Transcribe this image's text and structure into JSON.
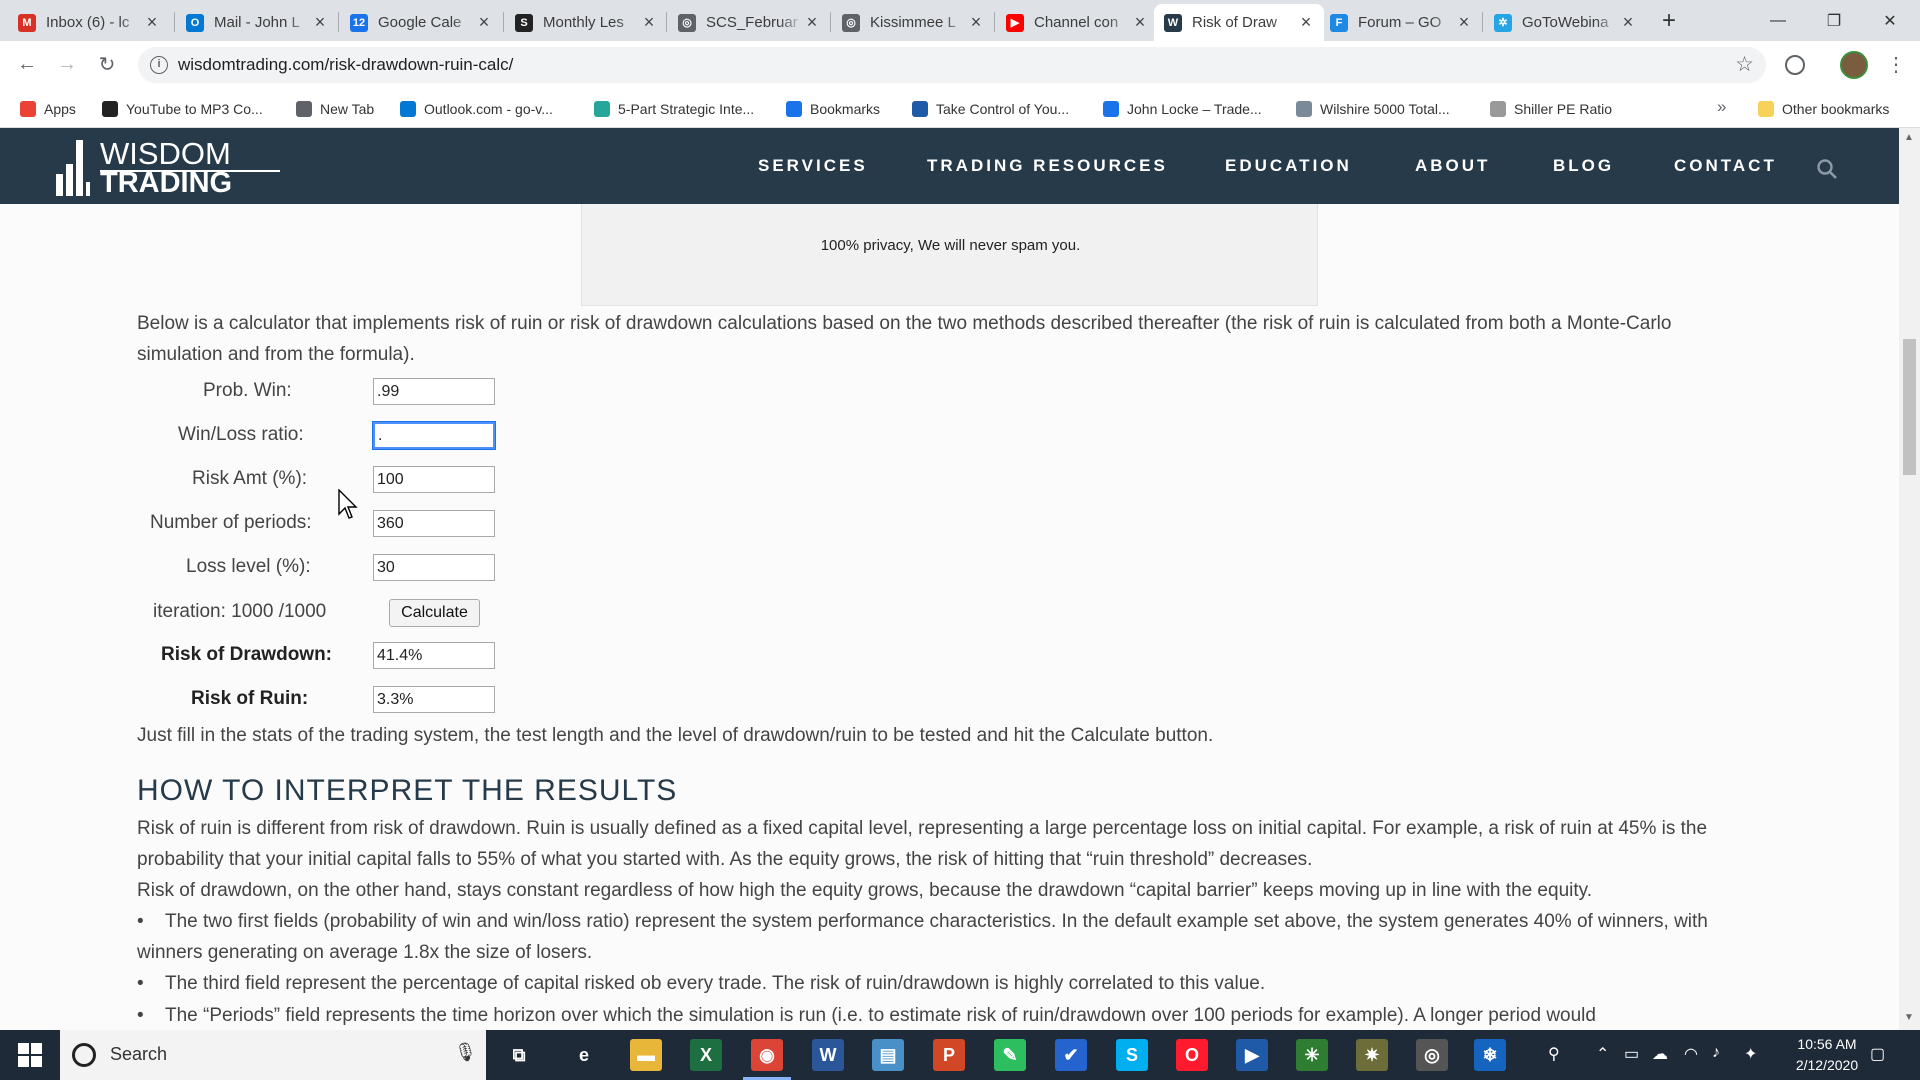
{
  "browser": {
    "tabs": [
      {
        "title": "Inbox (6) - lc",
        "icon": "gmail-icon",
        "color": "#d93025",
        "glyph": "M",
        "active": false
      },
      {
        "title": "Mail - John L",
        "icon": "outlook-icon",
        "color": "#0078d4",
        "glyph": "O",
        "active": false
      },
      {
        "title": "Google Cale",
        "icon": "calendar-icon",
        "color": "#1a73e8",
        "glyph": "12",
        "active": false
      },
      {
        "title": "Monthly Les",
        "icon": "scs-icon",
        "color": "#222222",
        "glyph": "S",
        "active": false
      },
      {
        "title": "SCS_Februar",
        "icon": "globe-icon",
        "color": "#5f6368",
        "glyph": "◎",
        "active": false
      },
      {
        "title": "Kissimmee L",
        "icon": "globe-icon",
        "color": "#5f6368",
        "glyph": "◎",
        "active": false
      },
      {
        "title": "Channel con",
        "icon": "youtube-icon",
        "color": "#ff0000",
        "glyph": "▶",
        "active": false
      },
      {
        "title": "Risk of Draw",
        "icon": "wisdom-icon",
        "color": "#263a4a",
        "glyph": "W",
        "active": true
      },
      {
        "title": "Forum – GO",
        "icon": "forum-icon",
        "color": "#1e88e5",
        "glyph": "F",
        "active": false
      },
      {
        "title": "GoToWebina",
        "icon": "gotowebinar-icon",
        "color": "#26a5e4",
        "glyph": "✲",
        "active": false
      }
    ],
    "new_tab": "+",
    "minimize": "—",
    "maximize": "❐",
    "close": "✕",
    "url": "wisdomtrading.com/risk-drawdown-ruin-calc/",
    "bookmarks": [
      {
        "label": "Apps",
        "icon": "apps-grid-icon",
        "color": "#ea4335"
      },
      {
        "label": "YouTube to MP3 Co...",
        "icon": "music-note-icon",
        "color": "#222222"
      },
      {
        "label": "New Tab",
        "icon": "globe-icon",
        "color": "#5f6368"
      },
      {
        "label": "Outlook.com - go-v...",
        "icon": "outlook-icon",
        "color": "#0078d4"
      },
      {
        "label": "5-Part Strategic Inte...",
        "icon": "circle-icon",
        "color": "#26a69a"
      },
      {
        "label": "Bookmarks",
        "icon": "star-icon",
        "color": "#1a73e8"
      },
      {
        "label": "Take Control of You...",
        "icon": "edge-icon",
        "color": "#1e5aa8"
      },
      {
        "label": "John Locke – Trade...",
        "icon": "lock-doc-icon",
        "color": "#1a73e8"
      },
      {
        "label": "Wilshire 5000 Total...",
        "icon": "chart-icon",
        "color": "#7a8a99"
      },
      {
        "label": "Shiller PE Ratio",
        "icon": "moon-icon",
        "color": "#999999"
      }
    ],
    "bookmarks_more": "»",
    "other_bookmarks": "Other bookmarks"
  },
  "site": {
    "logo_top": "WISDOM",
    "logo_bottom": "TRADING",
    "nav": [
      "SERVICES",
      "TRADING RESOURCES",
      "EDUCATION",
      "ABOUT",
      "BLOG",
      "CONTACT"
    ],
    "privacy_note": "100% privacy, We will never spam you.",
    "intro": "Below is a calculator that implements risk of ruin or risk of drawdown calculations based on the two methods described thereafter (the risk of ruin is calculated from both a Monte-Carlo simulation and from the formula).",
    "form": {
      "prob_win_label": "Prob. Win:",
      "prob_win_value": ".99",
      "wl_ratio_label": "Win/Loss ratio:",
      "wl_ratio_value": ".",
      "risk_amt_label": "Risk Amt (%):",
      "risk_amt_value": "100",
      "periods_label": "Number of periods:",
      "periods_value": "360",
      "loss_level_label": "Loss level (%):",
      "loss_level_value": "30",
      "iteration_label": "iteration: 1000 /1000",
      "calculate_label": "Calculate",
      "drawdown_label": "Risk of Drawdown:",
      "drawdown_value": "41.4%",
      "ruin_label": "Risk of Ruin:",
      "ruin_value": "3.3%"
    },
    "instructions": "Just fill in the stats of the trading system, the test length and the level of drawdown/ruin to be tested and hit the Calculate button.",
    "heading": "HOW TO INTERPRET THE RESULTS",
    "p1": "Risk of ruin is different from risk of drawdown. Ruin is usually defined as a fixed capital level, representing a large percentage loss on initial capital. For example, a risk of ruin at 45% is the probability that your initial capital falls to 55% of what you started with. As the equity grows, the risk of hitting that “ruin threshold” decreases.",
    "p2": "Risk of drawdown, on the other hand, stays constant regardless of how high the equity grows, because the drawdown “capital barrier” keeps moving up in line with the equity.",
    "bullets": [
      "The two first fields (probability of win and win/loss ratio) represent the system performance characteristics. In the default example set above, the system generates 40% of winners, with winners generating on average 1.8x the size of losers.",
      "The third field represent the percentage of capital risked ob every trade. The risk of ruin/drawdown is highly correlated to this value.",
      "The “Periods” field represents the time horizon over which the simulation is run (i.e. to estimate risk of ruin/drawdown over 100 periods for example). A longer period would"
    ]
  },
  "taskbar": {
    "search_placeholder": "Search",
    "apps": [
      {
        "name": "task-view-icon",
        "glyph": "⧉",
        "color": "#1f2a38"
      },
      {
        "name": "edge-icon",
        "glyph": "e",
        "color": "#1f2a38"
      },
      {
        "name": "file-explorer-icon",
        "glyph": "▬",
        "color": "#e8b73a"
      },
      {
        "name": "excel-icon",
        "glyph": "X",
        "color": "#1d6f42"
      },
      {
        "name": "chrome-icon",
        "glyph": "◉",
        "color": "#db4437"
      },
      {
        "name": "word-icon",
        "glyph": "W",
        "color": "#2b579a"
      },
      {
        "name": "notebook-icon",
        "glyph": "▤",
        "color": "#4a90c8"
      },
      {
        "name": "powerpoint-icon",
        "glyph": "P",
        "color": "#d24726"
      },
      {
        "name": "evernote-icon",
        "glyph": "✎",
        "color": "#2dbe60"
      },
      {
        "name": "todo-icon",
        "glyph": "✔",
        "color": "#2564cf"
      },
      {
        "name": "skype-icon",
        "glyph": "S",
        "color": "#00aff0"
      },
      {
        "name": "opera-icon",
        "glyph": "O",
        "color": "#ff1b2d"
      },
      {
        "name": "media-player-icon",
        "glyph": "▶",
        "color": "#1e5aa8"
      },
      {
        "name": "app-green-icon",
        "glyph": "✳",
        "color": "#2e7d32"
      },
      {
        "name": "app-spark-icon",
        "glyph": "✷",
        "color": "#6d6d3a"
      },
      {
        "name": "obs-icon",
        "glyph": "◎",
        "color": "#555555"
      },
      {
        "name": "snowflake-icon",
        "glyph": "❄",
        "color": "#1565c0"
      }
    ],
    "time": "10:56 AM",
    "date": "2/12/2020"
  }
}
